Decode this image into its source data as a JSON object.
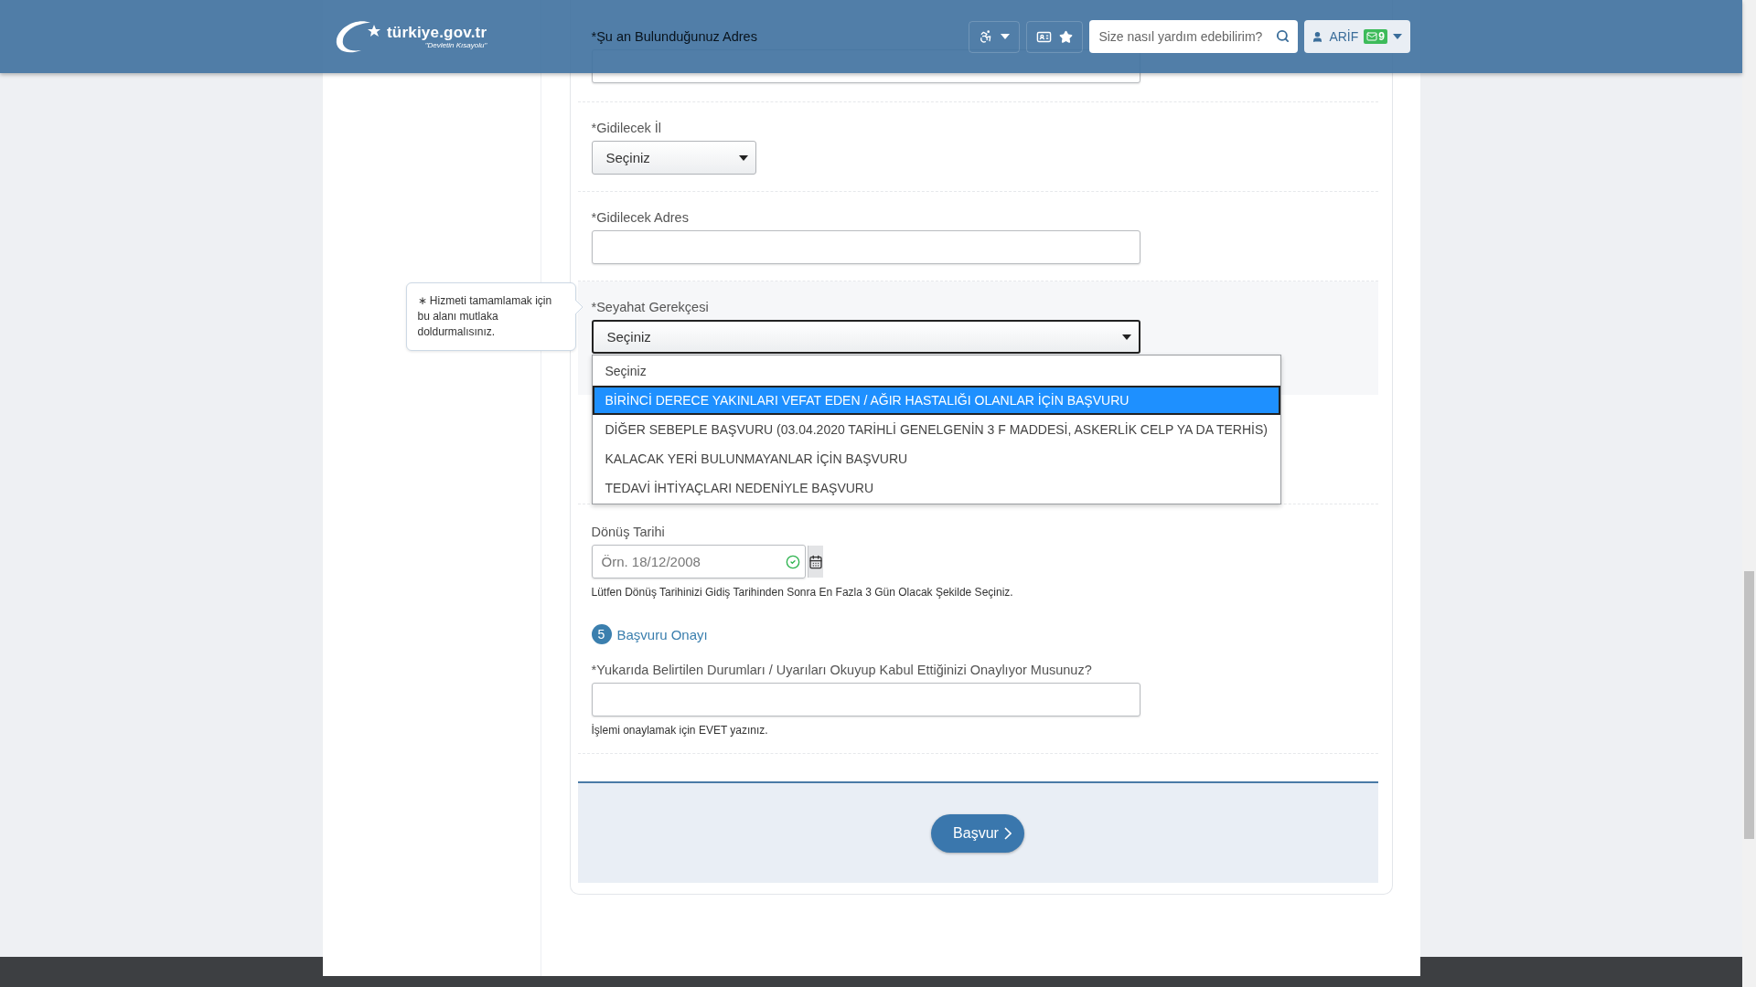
{
  "header": {
    "logo_text": "türkiye.gov.tr",
    "logo_tagline": "\"Devletin Kısayolu\"",
    "search": {
      "placeholder": "Size nasıl yardım edebilirim?"
    },
    "user": {
      "name": "ARİF",
      "mail_count": "9"
    }
  },
  "fields": [
    {
      "kind": "text",
      "label": "*Şu an Bulunduğunuz Adres"
    },
    {
      "kind": "select",
      "label": "*Gidilecek İl",
      "value": "Seçiniz"
    },
    {
      "kind": "text",
      "label": "*Gidilecek Adres"
    },
    {
      "kind": "wideselect",
      "label": "*Seyahat Gerekçesi",
      "value": "Seçiniz",
      "focused": true,
      "tooltip": "∗ Hizmeti tamamlamak için bu alanı mutlaka doldurmalısınız.",
      "expanded": true,
      "options": [
        {
          "label": "Seçiniz",
          "highlighted": false
        },
        {
          "label": "BİRİNCİ DERECE YAKINLARI VEFAT EDEN / AĞIR HASTALIĞI OLANLAR İÇİN BAŞVURU",
          "highlighted": true
        },
        {
          "label": "DİĞER SEBEPLE BAŞVURU (03.04.2020 TARİHLİ GENELGENİN 3 F MADDESİ, ASKERLİK CELP YA DA TERHİS)",
          "highlighted": false
        },
        {
          "label": "KALACAK YERİ BULUNMAYANLAR İÇİN BAŞVURU",
          "highlighted": false
        },
        {
          "label": "TEDAVİ İHTİYAÇLARI NEDENİYLE BAŞVURU",
          "highlighted": false
        }
      ]
    },
    {
      "kind": "hidden"
    },
    {
      "kind": "date",
      "label": "Dönüş Tarihi",
      "placeholder": "Örn. 18/12/2008",
      "valid": true,
      "help": "Lütfen Dönüş Tarihinizi Gidiş Tarihinden Sonra En Fazla 3 Gün Olacak Şekilde Seçiniz."
    },
    {
      "kind": "step",
      "number": "5",
      "title": "Başvuru Onayı"
    },
    {
      "kind": "text",
      "label": "*Yukarıda Belirtilen Durumları / Uyarıları Okuyup Kabul Ettiğinizi Onaylıyor Musunuz?",
      "help": "İşlemi onaylamak için EVET yazınız."
    }
  ],
  "submit": "Başvur"
}
